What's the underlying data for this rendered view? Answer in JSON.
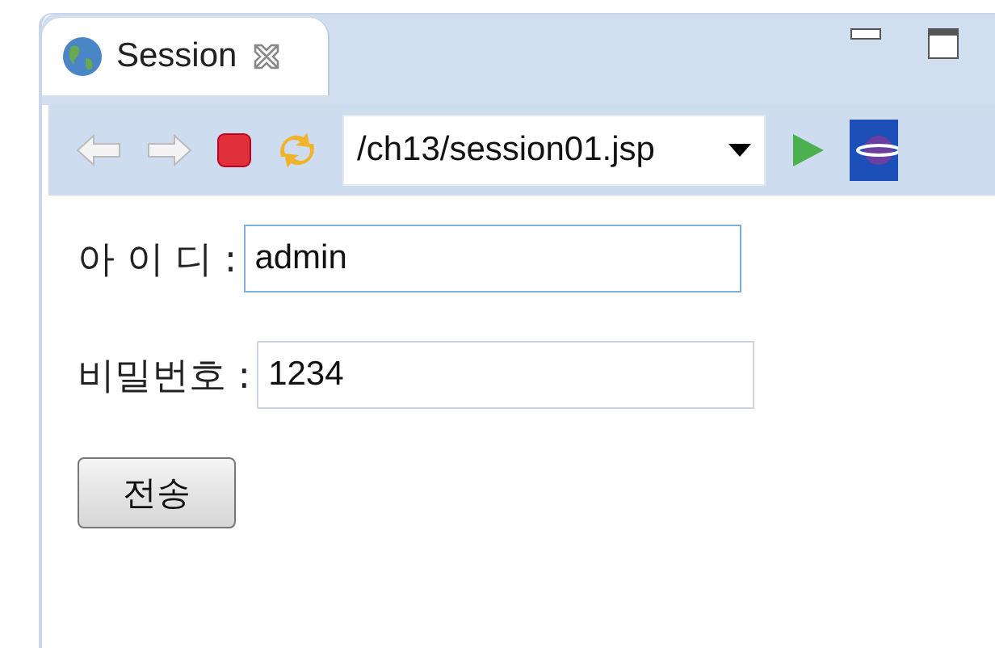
{
  "tab": {
    "title": "Session",
    "selected": true
  },
  "toolbar": {
    "url": "/ch13/session01.jsp"
  },
  "form": {
    "fields": [
      {
        "label": "아 이 디 :",
        "value": "admin",
        "focused": true
      },
      {
        "label": "비밀번호 :",
        "value": "1234",
        "focused": false
      }
    ],
    "submit": "전송"
  }
}
